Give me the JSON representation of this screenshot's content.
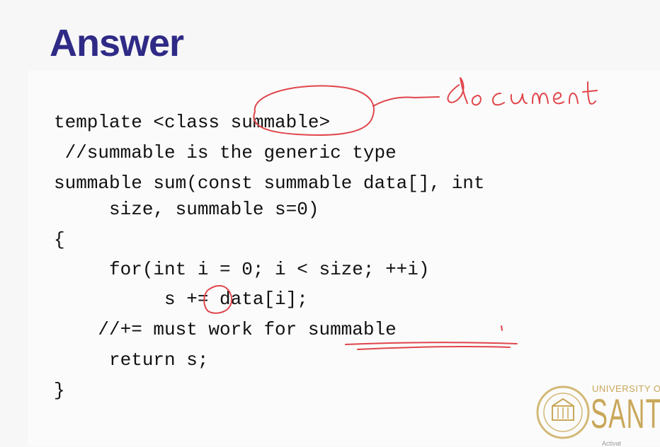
{
  "slide": {
    "title": "Answer",
    "code_lines": [
      "template <class summable>",
      " //summable is the generic type",
      "summable sum(const summable data[], int",
      "     size, summable s=0)",
      "{",
      "     for(int i = 0; i < size; ++i)",
      "          s += data[i];",
      "    //+= must work for summable",
      "     return s;",
      "}"
    ]
  },
  "annotations": {
    "handwritten_note": "document"
  },
  "logo": {
    "top_text": "UNIVERSITY O",
    "big_text": "SANTA",
    "tiny_text": "Activat"
  },
  "colors": {
    "title": "#2f2a86",
    "ink": "#e0454a",
    "logo": "#c9a85a"
  }
}
